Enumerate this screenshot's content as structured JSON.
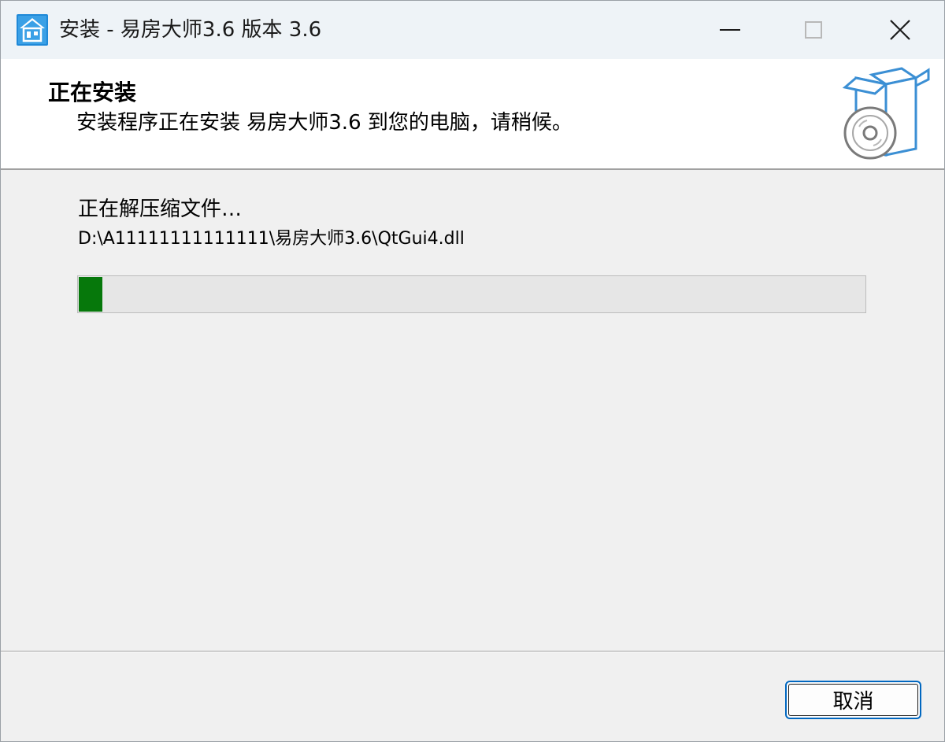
{
  "window": {
    "title": "安装 - 易房大师3.6 版本 3.6",
    "app_icon": "house-icon",
    "controls": {
      "minimize_icon": "minimize-icon",
      "maximize_icon": "maximize-icon",
      "close_icon": "close-icon"
    }
  },
  "header": {
    "title": "正在安装",
    "subtitle": "安装程序正在安装 易房大师3.6 到您的电脑，请稍候。",
    "graphic_icon": "setup-box-disc-icon"
  },
  "body": {
    "status_text": "正在解压缩文件…",
    "current_file": "D:\\A11111111111111\\易房大师3.6\\QtGui4.dll",
    "progress": {
      "percent": 3,
      "color": "#06780b"
    }
  },
  "footer": {
    "cancel_label": "取消"
  },
  "colors": {
    "accent": "#0067c0",
    "progress_green": "#06780b",
    "graphic_blue": "#3b8fd4"
  }
}
